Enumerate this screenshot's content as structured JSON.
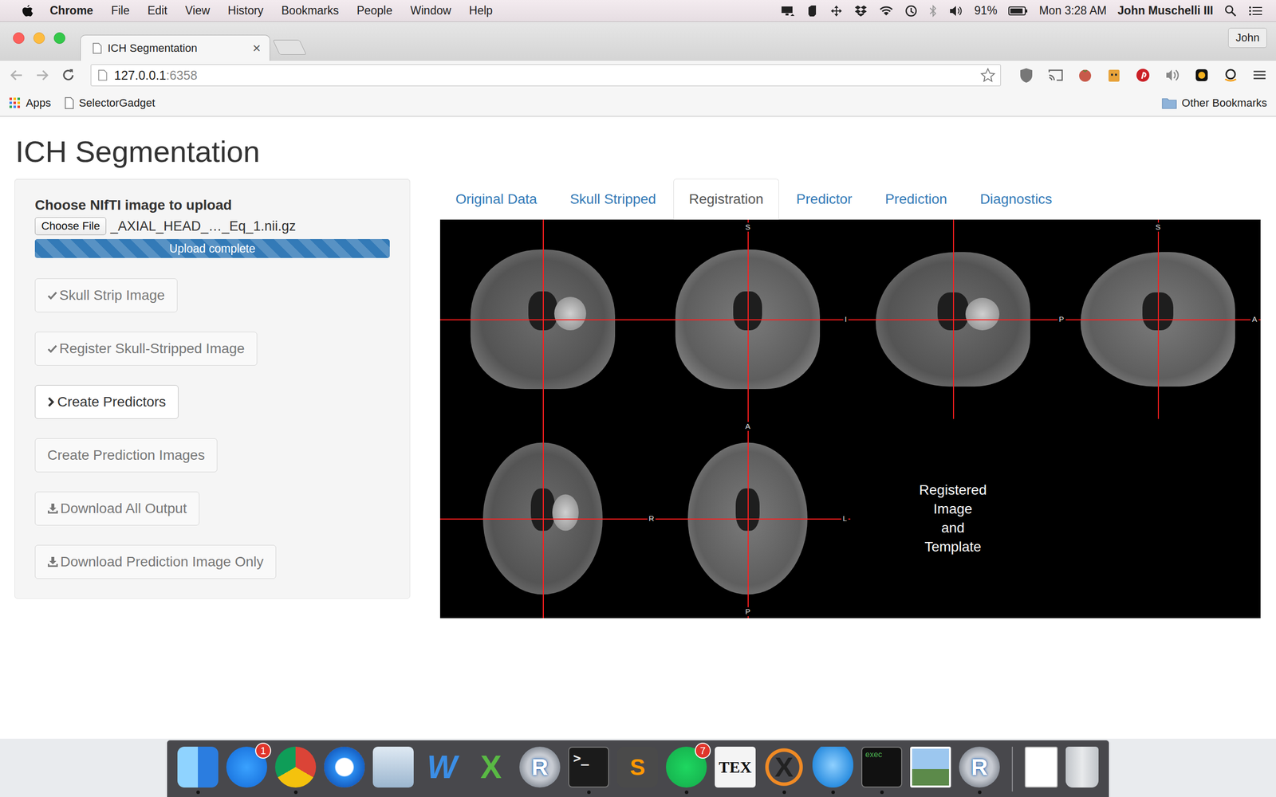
{
  "menubar": {
    "app": "Chrome",
    "items": [
      "File",
      "Edit",
      "View",
      "History",
      "Bookmarks",
      "People",
      "Window",
      "Help"
    ],
    "battery": {
      "reading": "91%",
      "level": 0.91
    },
    "clock": "Mon 3:28 AM",
    "user": "John Muschelli III"
  },
  "browser": {
    "tabs": [
      {
        "title": "ICH Segmentation",
        "close": "×",
        "selected": true
      }
    ],
    "profile": "John",
    "url": {
      "host": "127.0.0.1",
      "port": ":6358"
    },
    "bookmarks": [
      {
        "label": "Apps",
        "kind": "apps"
      },
      {
        "label": "SelectorGadget",
        "kind": "page"
      }
    ],
    "other_bookmarks": "Other Bookmarks"
  },
  "page": {
    "title": "ICH Segmentation",
    "upload": {
      "label": "Choose NIfTI image to upload",
      "button": "Choose File",
      "filename": "_AXIAL_HEAD_…_Eq_1.nii.gz",
      "progress": {
        "label": "Upload complete",
        "level": 1
      }
    },
    "actions": [
      {
        "label": "Skull Strip Image",
        "kind": "done",
        "disabled": true
      },
      {
        "label": "Register Skull-Stripped Image",
        "kind": "done",
        "disabled": true
      },
      {
        "label": "Create Predictors",
        "kind": "next",
        "disabled": false
      },
      {
        "label": "Create Prediction Images",
        "kind": "plain",
        "disabled": true
      },
      {
        "label": "Download All Output",
        "kind": "download",
        "disabled": true
      },
      {
        "label": "Download Prediction Image Only",
        "kind": "download",
        "disabled": true
      }
    ],
    "tabs": [
      {
        "label": "Original Data",
        "selected": false
      },
      {
        "label": "Skull Stripped",
        "selected": false
      },
      {
        "label": "Registration",
        "selected": true
      },
      {
        "label": "Predictor",
        "selected": false
      },
      {
        "label": "Prediction",
        "selected": false
      },
      {
        "label": "Diagnostics",
        "selected": false
      }
    ],
    "viewer": {
      "panes": [
        {
          "kind": "coronal",
          "source": "registered",
          "lesion": true,
          "crosshair": true,
          "labels": {}
        },
        {
          "kind": "coronal",
          "source": "template",
          "lesion": false,
          "crosshair": true,
          "labels": {
            "top": "S",
            "right": "I"
          }
        },
        {
          "kind": "sagittal",
          "source": "registered",
          "lesion": true,
          "crosshair": true,
          "labels": {}
        },
        {
          "kind": "sagittal",
          "source": "template",
          "lesion": false,
          "crosshair": true,
          "labels": {
            "top": "S",
            "left": "P",
            "right": "A"
          }
        },
        {
          "kind": "axial",
          "source": "registered",
          "lesion": true,
          "crosshair": true,
          "labels": {}
        },
        {
          "kind": "axial",
          "source": "template",
          "lesion": false,
          "crosshair": true,
          "labels": {
            "top": "A",
            "left": "R",
            "right": "L",
            "bottom": "P"
          }
        },
        {
          "kind": "caption",
          "lines": [
            "Registered",
            "Image",
            "and",
            "Template"
          ]
        },
        {
          "kind": "empty"
        }
      ]
    }
  },
  "dock": [
    {
      "kind": "finder",
      "running": true
    },
    {
      "kind": "appstore",
      "badge": "1",
      "running": false
    },
    {
      "kind": "chrome",
      "running": true
    },
    {
      "kind": "safari",
      "running": false
    },
    {
      "kind": "preview3d",
      "running": false
    },
    {
      "kind": "wordlogo",
      "label": "W",
      "running": false
    },
    {
      "kind": "xlogo",
      "label": "X",
      "running": false
    },
    {
      "kind": "rlang",
      "label": "R",
      "running": false
    },
    {
      "kind": "terminal",
      "label": ">_",
      "running": true
    },
    {
      "kind": "sublime",
      "label": "S",
      "running": false
    },
    {
      "kind": "spotify",
      "badge": "7",
      "running": true
    },
    {
      "kind": "tex",
      "label": "TEX",
      "running": false
    },
    {
      "kind": "xquartz",
      "label": "X",
      "running": true
    },
    {
      "kind": "messages",
      "running": true
    },
    {
      "kind": "exec",
      "label": "exec",
      "running": true
    },
    {
      "kind": "photos",
      "running": false
    },
    {
      "kind": "rlang",
      "label": "R",
      "running": true
    },
    {
      "kind": "separator",
      "running": false
    },
    {
      "kind": "file",
      "running": false
    },
    {
      "kind": "trash",
      "running": false
    }
  ]
}
